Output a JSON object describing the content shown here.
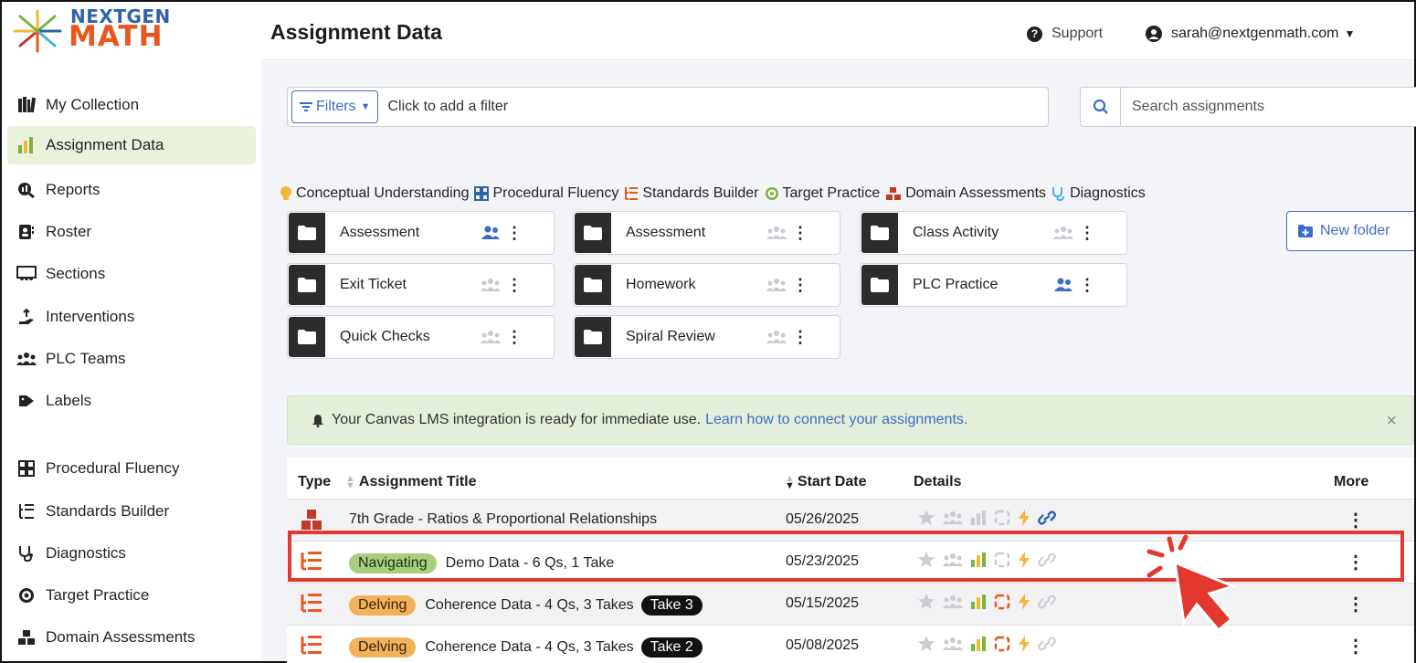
{
  "logo": {
    "line1": "NEXTGEN",
    "line2": "MATH"
  },
  "sidebar": {
    "items": [
      {
        "label": "My Collection",
        "icon": "books-icon"
      },
      {
        "label": "Assignment Data",
        "icon": "bar-chart-icon",
        "active": true
      },
      {
        "label": "Reports",
        "icon": "magnify-chart-icon"
      },
      {
        "label": "Roster",
        "icon": "address-book-icon"
      },
      {
        "label": "Sections",
        "icon": "chalkboard-icon"
      },
      {
        "label": "Interventions",
        "icon": "hand-icon"
      },
      {
        "label": "PLC Teams",
        "icon": "people-group-icon"
      },
      {
        "label": "Labels",
        "icon": "tag-icon"
      },
      {
        "label": "Procedural Fluency",
        "icon": "grid-icon"
      },
      {
        "label": "Standards Builder",
        "icon": "list-tree-icon"
      },
      {
        "label": "Diagnostics",
        "icon": "stethoscope-icon"
      },
      {
        "label": "Target Practice",
        "icon": "target-icon"
      },
      {
        "label": "Domain Assessments",
        "icon": "cubes-icon"
      }
    ]
  },
  "header": {
    "title": "Assignment Data",
    "support": "Support",
    "user": "sarah@nextgenmath.com"
  },
  "filters": {
    "button": "Filters",
    "placeholder": "Click to add a filter"
  },
  "search": {
    "placeholder": "Search assignments"
  },
  "legend": [
    {
      "label": "Conceptual Understanding",
      "color": "#f4b73d"
    },
    {
      "label": "Procedural Fluency",
      "color": "#2d64a8"
    },
    {
      "label": "Standards Builder",
      "color": "#e8581e"
    },
    {
      "label": "Target Practice",
      "color": "#7bb43c"
    },
    {
      "label": "Domain Assessments",
      "color": "#c0392b"
    },
    {
      "label": "Diagnostics",
      "color": "#45b5d6"
    }
  ],
  "folders": [
    {
      "label": "Assessment",
      "shared": true
    },
    {
      "label": "Assessment",
      "shared": false
    },
    {
      "label": "Class Activity",
      "shared": false
    },
    {
      "label": "Exit Ticket",
      "shared": false
    },
    {
      "label": "Homework",
      "shared": false
    },
    {
      "label": "PLC Practice",
      "shared": true
    },
    {
      "label": "Quick Checks",
      "shared": false
    },
    {
      "label": "Spiral Review",
      "shared": false
    }
  ],
  "new_folder": "New folder",
  "alert": {
    "text": "Your Canvas LMS integration is ready for immediate use.",
    "link": "Learn how to connect your assignments.",
    "close": "×"
  },
  "table": {
    "headers": {
      "type": "Type",
      "title": "Assignment Title",
      "date": "Start Date",
      "details": "Details",
      "more": "More"
    },
    "rows": [
      {
        "type": "domain-assessment",
        "badge": "",
        "title": "7th Grade - Ratios & Proportional Relationships",
        "take": "",
        "date": "05/26/2025"
      },
      {
        "type": "standards-builder",
        "badge": "Navigating",
        "title": "Demo Data - 6 Qs, 1 Take",
        "take": "",
        "date": "05/23/2025"
      },
      {
        "type": "standards-builder",
        "badge": "Delving",
        "title": "Coherence Data - 4 Qs, 3 Takes",
        "take": "Take 3",
        "date": "05/15/2025"
      },
      {
        "type": "standards-builder",
        "badge": "Delving",
        "title": "Coherence Data - 4 Qs, 3 Takes",
        "take": "Take 2",
        "date": "05/08/2025"
      }
    ]
  },
  "colors": {
    "accent": "#3c6cc8",
    "highlight": "#e2382f",
    "active_nav": "#eaf2de"
  }
}
